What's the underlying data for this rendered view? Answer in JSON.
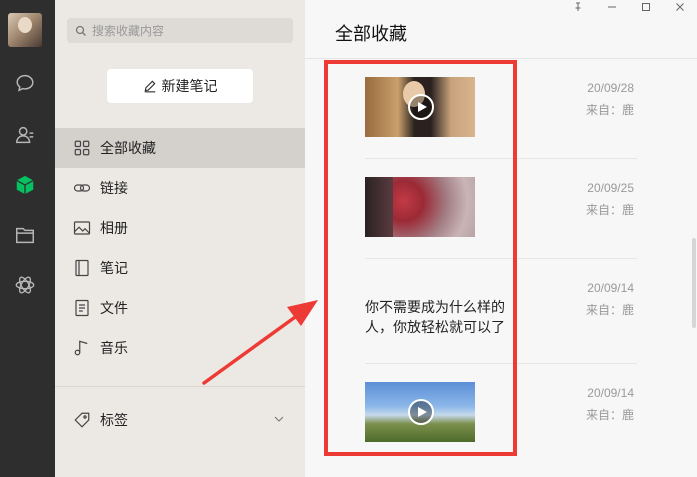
{
  "sidebar": {
    "icons": [
      "chat-icon",
      "contacts-icon",
      "favorites-cube-icon",
      "folder-icon",
      "mini-program-icon"
    ],
    "active_color": "#07c160"
  },
  "search": {
    "placeholder": "搜索收藏内容"
  },
  "new_note": {
    "label": "新建笔记"
  },
  "nav": {
    "items": [
      {
        "label": "全部收藏",
        "icon": "grid-icon",
        "active": true
      },
      {
        "label": "链接",
        "icon": "link-icon"
      },
      {
        "label": "相册",
        "icon": "image-icon"
      },
      {
        "label": "笔记",
        "icon": "notebook-icon"
      },
      {
        "label": "文件",
        "icon": "file-icon"
      },
      {
        "label": "音乐",
        "icon": "music-icon"
      }
    ],
    "tags_label": "标签"
  },
  "content": {
    "title": "全部收藏",
    "items": [
      {
        "type": "video",
        "date": "20/09/28",
        "source": "来自：鹿"
      },
      {
        "type": "image",
        "date": "20/09/25",
        "source": "来自：鹿"
      },
      {
        "type": "note",
        "text": "你不需要成为什么样的人，你放轻松就可以了",
        "date": "20/09/14",
        "source": "来自：鹿"
      },
      {
        "type": "video",
        "date": "20/09/14",
        "source": "来自：鹿"
      }
    ]
  },
  "annotation": {
    "color": "#ee3a35"
  }
}
